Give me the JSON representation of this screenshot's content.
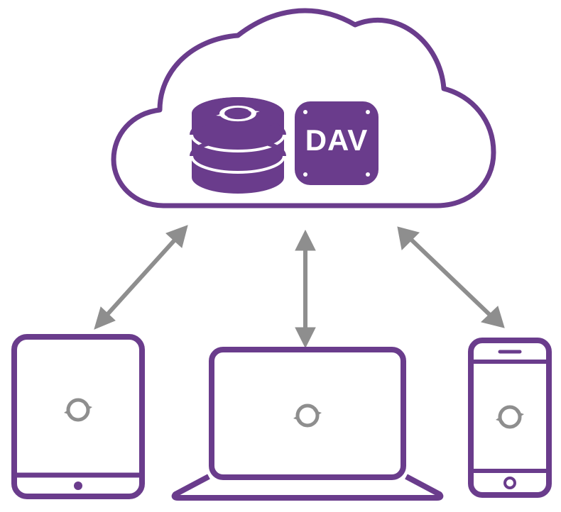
{
  "diagram": {
    "cloud": {
      "dav_label": "DAV"
    },
    "colors": {
      "purple": "#6a3c8c",
      "gray": "#8e8e8e"
    }
  }
}
